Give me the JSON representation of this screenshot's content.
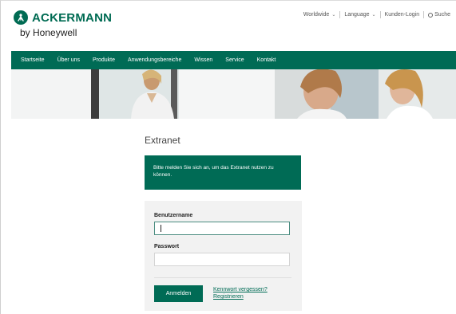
{
  "brand": {
    "name": "ACKERMANN",
    "tagline": "by Honeywell"
  },
  "top_nav": {
    "worldwide": "Worldwide",
    "language": "Language",
    "customer_login": "Kunden-Login",
    "search": "Suche"
  },
  "main_nav": [
    "Startseite",
    "Über uns",
    "Produkte",
    "Anwendungsbereiche",
    "Wissen",
    "Service",
    "Kontakt"
  ],
  "page": {
    "title": "Extranet",
    "notice": "Bitte melden Sie sich an, um das Extranet nutzen zu können."
  },
  "login": {
    "username_label": "Benutzername",
    "username_value": "",
    "password_label": "Passwort",
    "password_value": "",
    "submit": "Anmelden",
    "forgot_password": "Kennwort vergessen?",
    "register": "Registrieren"
  },
  "colors": {
    "brand_green": "#006b55",
    "login_panel": "#f2f2f2"
  }
}
